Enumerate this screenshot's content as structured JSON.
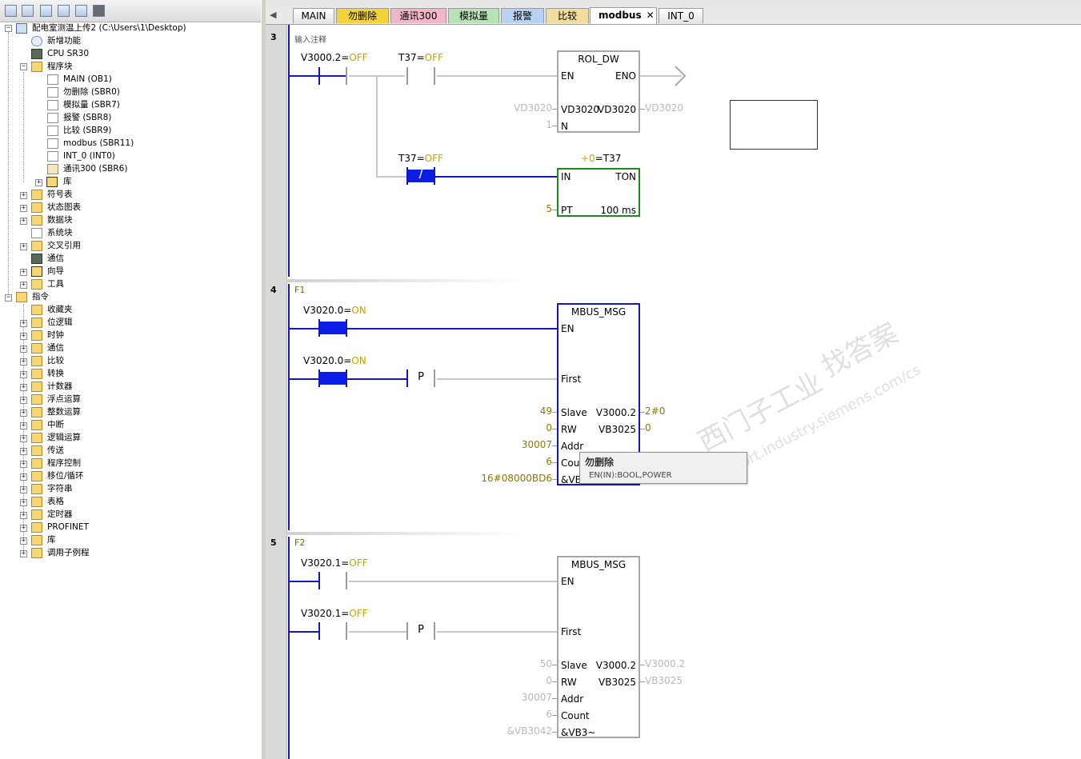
{
  "tree": {
    "project": "配电室测温上传2 (C:\\Users\\1\\Desktop)",
    "new_feature": "新增功能",
    "cpu": "CPU SR30",
    "program_block": "程序块",
    "main": "MAIN (OB1)",
    "sbr0": "勿删除 (SBR0)",
    "sbr7": "模拟量 (SBR7)",
    "sbr8": "报警 (SBR8)",
    "sbr9": "比较 (SBR9)",
    "sbr11": "modbus (SBR11)",
    "int0": "INT_0 (INT0)",
    "sbr6": "通讯300 (SBR6)",
    "lib": "库",
    "symbols": "符号表",
    "status_chart": "状态图表",
    "data_block": "数据块",
    "system_block": "系统块",
    "cross_ref": "交叉引用",
    "comm": "通信",
    "wizard": "向导",
    "tools": "工具",
    "instructions": "指令",
    "favorites": "收藏夹",
    "bit_logic": "位逻辑",
    "clock": "时钟",
    "comm2": "通信",
    "compare": "比较",
    "convert": "转换",
    "counter": "计数器",
    "float_math": "浮点运算",
    "int_math": "整数运算",
    "interrupt": "中断",
    "logic_ops": "逻辑运算",
    "move": "传送",
    "program_ctrl": "程序控制",
    "shift_rotate": "移位/循环",
    "string": "字符串",
    "table": "表格",
    "timer": "定时器",
    "profinet": "PROFINET",
    "lib2": "库",
    "call_sub": "调用子例程"
  },
  "tabs": {
    "main": "MAIN",
    "sbr0": "勿删除",
    "sbr6": "通讯300",
    "sbr7": "模拟量",
    "sbr8": "报警",
    "sbr9": "比较",
    "sbr11": "modbus",
    "int0": "INT_0",
    "close": "✕"
  },
  "net3": {
    "num": "3",
    "comment": "输入注释",
    "c1_addr": "V3000.2=",
    "c1_state": "OFF",
    "c2_addr": "T37=",
    "c2_state": "OFF",
    "box_title": "ROL_DW",
    "pin_en": "EN",
    "pin_eno": "ENO",
    "in_val": "VD3020",
    "pin_in": "VD3020",
    "pin_out": "VD3020",
    "out_val": "VD3020",
    "n_val": "1",
    "pin_n": "N",
    "c3_addr": "T37=",
    "c3_state": "OFF",
    "c3_symbol": "/",
    "t_prefix": "+0",
    "t_name": "=T37",
    "t_in": "IN",
    "t_ton": "TON",
    "pt_val": "5",
    "pin_pt": "PT",
    "t_base": "100 ms"
  },
  "net4": {
    "num": "4",
    "comment": "F1",
    "c1_addr": "V3020.0=",
    "c1_state": "ON",
    "c2_addr": "V3020.0=",
    "c2_state": "ON",
    "p_label": "P",
    "box_title": "MBUS_MSG",
    "pin_en": "EN",
    "pin_first": "First",
    "slave_val": "49",
    "pin_slave": "Slave",
    "done_pin": "V3000.2",
    "done_val": "2#0",
    "rw_val": "0",
    "pin_rw": "RW",
    "err_pin": "VB3025",
    "err_val": "0",
    "addr_val": "30007",
    "pin_addr": "Addr",
    "count_val": "6",
    "pin_count": "Cou",
    "dp_val": "16#08000BD6",
    "pin_dp": "&VB"
  },
  "tooltip": {
    "title": "勿删除",
    "sig": "EN(IN):BOOL,POWER"
  },
  "net5": {
    "num": "5",
    "comment": "F2",
    "c1_addr": "V3020.1=",
    "c1_state": "OFF",
    "c2_addr": "V3020.1=",
    "c2_state": "OFF",
    "p_label": "P",
    "box_title": "MBUS_MSG",
    "pin_en": "EN",
    "pin_first": "First",
    "slave_val": "50",
    "pin_slave": "Slave",
    "done_pin": "V3000.2",
    "done_val": "V3000.2",
    "rw_val": "0",
    "pin_rw": "RW",
    "err_pin": "VB3025",
    "err_val": "VB3025",
    "addr_val": "30007",
    "pin_addr": "Addr",
    "count_val": "6",
    "pin_count": "Count",
    "dp_val": "&VB3042",
    "pin_dp": "&VB3~"
  },
  "watermark": {
    "line1": "西门子工业",
    "line2": "support.industry.siemens.com/cs",
    "line3": "找答案"
  },
  "colors": {
    "power_flow": "#1515c8",
    "contact_on": "#0a1ee6",
    "state_text": "#c8a000",
    "green_box": "#1e8a1e"
  }
}
